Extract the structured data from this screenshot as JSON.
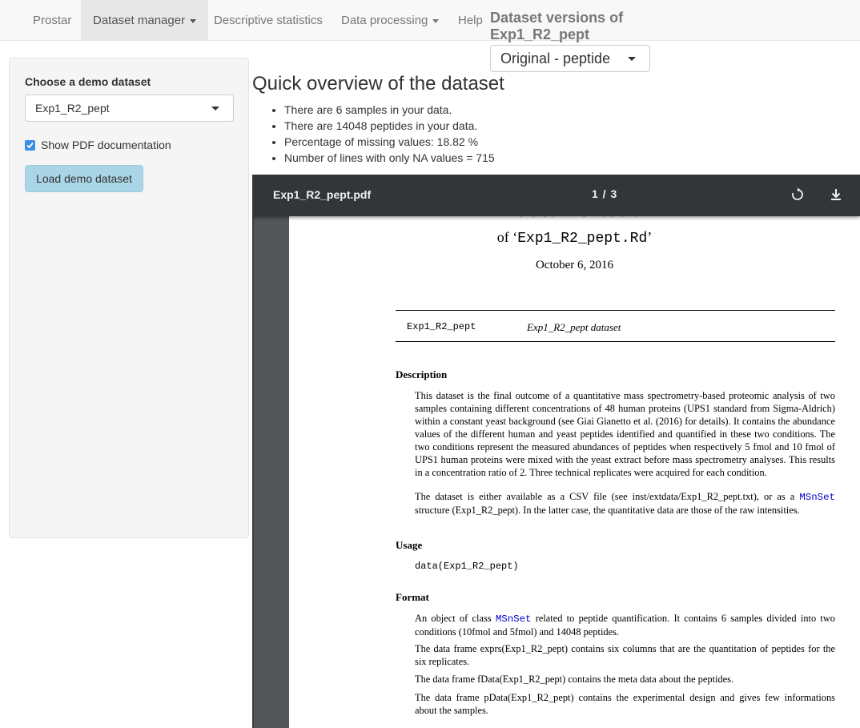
{
  "navbar": {
    "brand": "Prostar",
    "items": [
      {
        "label": "Dataset manager"
      },
      {
        "label": "Descriptive statistics"
      },
      {
        "label": "Data processing"
      },
      {
        "label": "Help"
      }
    ],
    "versions_label": "Dataset versions of Exp1_R2_pept",
    "versions_selected": "Original - peptide"
  },
  "sidebar": {
    "choose_label": "Choose a demo dataset",
    "selected_dataset": "Exp1_R2_pept",
    "show_pdf_label": "Show PDF documentation",
    "show_pdf_checked": true,
    "load_button": "Load demo dataset",
    "accent_color": "#3b8ee5"
  },
  "overview": {
    "title": "Quick overview of the dataset",
    "items": [
      "There are 6 samples in your data.",
      "There are 14048 peptides in your data.",
      "Percentage of missing values: 18.82 %",
      "Number of lines with only NA values = 715"
    ]
  },
  "pdf_viewer": {
    "filename": "Exp1_R2_pept.pdf",
    "page_indicator": "1 / 3",
    "rotate_icon": "rotate-icon",
    "download_icon": "download-icon",
    "doc": {
      "title": "R documentation",
      "subtitle_prefix": "of ‘",
      "subtitle_code": "Exp1_R2_pept.Rd",
      "subtitle_suffix": "’",
      "date": "October 6, 2016",
      "topic_name": "Exp1_R2_pept",
      "topic_desc": "Exp1_R2_pept dataset",
      "description_head": "Description",
      "description_p1": "This dataset is the final outcome of a quantitative mass spectrometry-based proteomic analysis of two samples containing different concentrations of 48 human proteins (UPS1 standard from Sigma-Aldrich) within a constant yeast background (see Giai Gianetto et al. (2016) for details). It contains the abundance values of the different human and yeast peptides identified and quantified in these two conditions. The two conditions represent the measured abundances of peptides when respectively 5 fmol and 10 fmol of UPS1 human proteins were mixed with the yeast extract before mass spectrometry analyses. This results in a concentration ratio of 2. Three technical replicates were acquired for each condition.",
      "description_p2_a": "The dataset is either available as a CSV file (see inst/extdata/Exp1_R2_pept.txt), or as a ",
      "description_p2_code": "MSnSet",
      "description_p2_b": " structure (Exp1_R2_pept). In the latter case, the quantitative data are those of the raw intensities.",
      "usage_head": "Usage",
      "usage_code": "data(Exp1_R2_pept)",
      "format_head": "Format",
      "format_p1_a": "An object of class ",
      "format_p1_code": "MSnSet",
      "format_p1_b": " related to peptide quantification. It contains 6 samples divided into two conditions (10fmol and 5fmol) and 14048 peptides.",
      "format_p2": "The data frame exprs(Exp1_R2_pept) contains six columns that are the quantitation of peptides for the six replicates.",
      "format_p3": "The data frame fData(Exp1_R2_pept) contains the meta data about the peptides.",
      "format_p4": "The data frame pData(Exp1_R2_pept) contains the experimental design and gives few informations about the samples."
    }
  }
}
